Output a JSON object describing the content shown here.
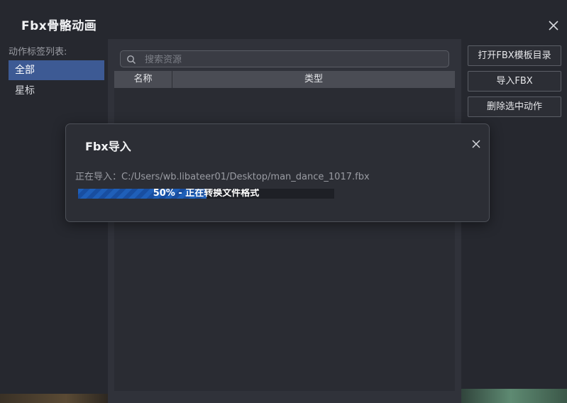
{
  "window": {
    "title": "Fbx骨骼动画",
    "close_icon": "close-icon"
  },
  "sidebar": {
    "label": "动作标签列表:",
    "items": [
      {
        "label": "全部",
        "active": true
      },
      {
        "label": "星标",
        "active": false
      }
    ]
  },
  "search": {
    "placeholder": "搜索资源",
    "value": "",
    "icon": "search-icon"
  },
  "table": {
    "columns": [
      "名称",
      "类型"
    ],
    "rows": []
  },
  "actions": [
    {
      "label": "打开FBX模板目录"
    },
    {
      "label": "导入FBX"
    },
    {
      "label": "删除选中动作"
    }
  ],
  "dialog": {
    "title": "Fbx导入",
    "close_icon": "close-icon",
    "import_line": "正在导入：C:/Users/wb.libateer01/Desktop/man_dance_1017.fbx",
    "progress": {
      "percent": 50,
      "text": "50% - 正在转换文件格式"
    }
  },
  "colors": {
    "accent": "#3d5a94",
    "progress": "#1f5fb8"
  }
}
